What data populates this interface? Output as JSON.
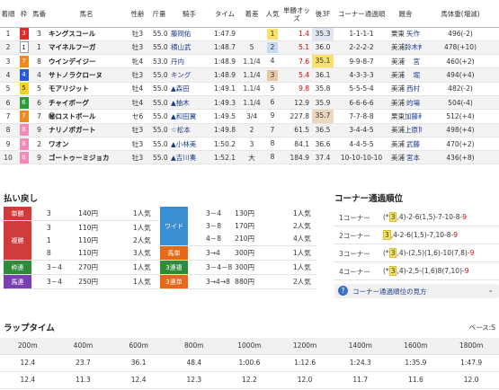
{
  "results": {
    "headers": [
      "着順",
      "枠",
      "馬番",
      "馬名",
      "性齢",
      "斤量",
      "騎手",
      "タイム",
      "着差",
      "人気",
      "単勝オッズ",
      "後3F",
      "コーナー通過順",
      "厩舎",
      "馬体重(増減)"
    ],
    "rows": [
      {
        "rank": "1",
        "frame": "3",
        "num": "3",
        "name": "キングスコール",
        "sex_age": "牡3",
        "weight": "55.0",
        "jockey": "藤岡佑",
        "time": "1:47.9",
        "margin": "",
        "pop": "1",
        "odds": "1.4",
        "last3f": "35.3",
        "corner": "1-1-1-1",
        "trainer": "矢作",
        "stable": "栗東",
        "bw": "496(-2)"
      },
      {
        "rank": "2",
        "frame": "1",
        "num": "1",
        "name": "マイネルフーガ",
        "sex_age": "牡3",
        "weight": "55.0",
        "jockey": "横山武",
        "time": "1:48.7",
        "margin": "5",
        "pop": "2",
        "odds": "5.1",
        "last3f": "36.0",
        "corner": "2-2-2-2",
        "trainer": "鈴木伸",
        "stable": "美浦",
        "bw": "478(+10)"
      },
      {
        "rank": "3",
        "frame": "7",
        "num": "8",
        "name": "ウインデイジー",
        "sex_age": "牝4",
        "weight": "53.0",
        "jockey": "丹内",
        "time": "1:48.9",
        "margin": "1.1/4",
        "pop": "4",
        "odds": "7.6",
        "last3f": "35.1",
        "corner": "9-9-8-7",
        "trainer": "宮",
        "stable": "美浦",
        "bw": "460(+2)"
      },
      {
        "rank": "4",
        "frame": "4",
        "num": "4",
        "name": "サトノラクローヌ",
        "sex_age": "牡3",
        "weight": "55.0",
        "jockey": "キング",
        "time": "1:48.9",
        "margin": "1.1/4",
        "pop": "3",
        "odds": "5.4",
        "last3f": "36.1",
        "corner": "4-3-3-3",
        "trainer": "堀",
        "stable": "美浦",
        "bw": "494(+4)"
      },
      {
        "rank": "5",
        "frame": "5",
        "num": "5",
        "name": "モアリジット",
        "sex_age": "牡4",
        "weight": "55.0",
        "jockey": "▲森田",
        "time": "1:49.1",
        "margin": "1.1/4",
        "pop": "5",
        "odds": "9.8",
        "last3f": "35.8",
        "corner": "5-5-5-4",
        "trainer": "西村",
        "stable": "美浦",
        "bw": "482(-2)"
      },
      {
        "rank": "6",
        "frame": "6",
        "num": "6",
        "name": "チャイボーグ",
        "sex_age": "牡4",
        "weight": "55.0",
        "jockey": "▲柚木",
        "time": "1:49.3",
        "margin": "1.1/4",
        "pop": "6",
        "odds": "12.9",
        "last3f": "35.9",
        "corner": "6-6-6-6",
        "trainer": "的場",
        "stable": "美浦",
        "bw": "504(-4)"
      },
      {
        "rank": "7",
        "frame": "7",
        "num": "7",
        "name": "㊙ロストボール",
        "sex_age": "セ6",
        "weight": "55.0",
        "jockey": "▲和田翼",
        "time": "1:49.5",
        "margin": "3/4",
        "pop": "9",
        "odds": "227.8",
        "last3f": "35.7",
        "corner": "7-7-8-8",
        "trainer": "加藤和",
        "stable": "栗東",
        "bw": "512(+4)"
      },
      {
        "rank": "8",
        "frame": "8",
        "num": "9",
        "name": "ナリノボガート",
        "sex_age": "牡3",
        "weight": "55.0",
        "jockey": "☆松本",
        "time": "1:49.8",
        "margin": "2",
        "pop": "7",
        "odds": "61.5",
        "last3f": "36.5",
        "corner": "3-4-4-5",
        "trainer": "上原博",
        "stable": "美浦",
        "bw": "498(+4)"
      },
      {
        "rank": "9",
        "frame": "8",
        "num": "2",
        "name": "ワオン",
        "sex_age": "牡3",
        "weight": "55.0",
        "jockey": "▲小林美",
        "time": "1:50.2",
        "margin": "3",
        "pop": "8",
        "odds": "84.1",
        "last3f": "36.6",
        "corner": "4-4-5-5",
        "trainer": "武藤",
        "stable": "美浦",
        "bw": "470(+2)"
      },
      {
        "rank": "10",
        "frame": "8",
        "num": "9",
        "name": "ゴートゥーミジョカ",
        "sex_age": "牡3",
        "weight": "55.0",
        "jockey": "▲吉川奏",
        "time": "1:52.1",
        "margin": "大",
        "pop": "8",
        "odds": "184.9",
        "last3f": "37.4",
        "corner": "10-10-10-10",
        "trainer": "宮本",
        "stable": "美浦",
        "bw": "436(+8)"
      }
    ]
  },
  "frame_colors": {
    "1": "#ffffff",
    "2": "#222222",
    "3": "#e02a2a",
    "4": "#2a5bd7",
    "5": "#f2d22a",
    "6": "#2f9a3a",
    "7": "#f08a1e",
    "8": "#f28cb6"
  },
  "payouts": {
    "title": "払い戻し",
    "left": [
      {
        "label": "単勝",
        "color": "#d23b3b",
        "rows": [
          {
            "combo": "3",
            "amount": "140円",
            "pop": "1人気"
          }
        ]
      },
      {
        "label": "複勝",
        "color": "#d23b3b",
        "rows": [
          {
            "combo": "3",
            "amount": "110円",
            "pop": "1人気"
          },
          {
            "combo": "1",
            "amount": "110円",
            "pop": "2人気"
          },
          {
            "combo": "8",
            "amount": "110円",
            "pop": "3人気"
          }
        ]
      },
      {
        "label": "枠連",
        "color": "#2f8a3a",
        "rows": [
          {
            "combo": "3－4",
            "amount": "270円",
            "pop": "1人気"
          }
        ]
      },
      {
        "label": "馬連",
        "color": "#7a3fb0",
        "rows": [
          {
            "combo": "3－4",
            "amount": "250円",
            "pop": "1人気"
          }
        ]
      }
    ],
    "right": [
      {
        "label": "ワイド",
        "color": "#3a8fd3",
        "rows": [
          {
            "combo": "3－4",
            "amount": "130円",
            "pop": "1人気"
          },
          {
            "combo": "3－8",
            "amount": "170円",
            "pop": "2人気"
          },
          {
            "combo": "4－8",
            "amount": "210円",
            "pop": "4人気"
          }
        ]
      },
      {
        "label": "馬単",
        "color": "#e46a1a",
        "rows": [
          {
            "combo": "3→4",
            "amount": "300円",
            "pop": "1人気"
          }
        ]
      },
      {
        "label": "3連複",
        "color": "#2f8a3a",
        "rows": [
          {
            "combo": "3－4－8",
            "amount": "300円",
            "pop": "1人気"
          }
        ]
      },
      {
        "label": "3連単",
        "color": "#e46a1a",
        "rows": [
          {
            "combo": "3→4→8",
            "amount": "880円",
            "pop": "2人気"
          }
        ]
      }
    ]
  },
  "corners": {
    "title": "コーナー通過順位",
    "link": "コーナー通過順位の見方",
    "rows": [
      {
        "label": "1コーナー",
        "pre": "(*",
        "hi": "3",
        "post": ",4)-2-6(1,5)-7-10-8-",
        "red": "9"
      },
      {
        "label": "2コーナー",
        "pre": "",
        "hi": "3",
        "post": ",4-2-6(1,5)-7,10-8-",
        "red": "9"
      },
      {
        "label": "3コーナー",
        "pre": "(*",
        "hi": "3",
        "post": ",4)-(2,5)(1,6)-10(7,8)-",
        "red": "9"
      },
      {
        "label": "4コーナー",
        "pre": "(*",
        "hi": "3",
        "post": ",4)-2,5-(1,6)8(7,10)-",
        "red": "9"
      }
    ]
  },
  "laps": {
    "title": "ラップタイム",
    "pace": "ペース:S",
    "distances": [
      "200m",
      "400m",
      "600m",
      "800m",
      "1000m",
      "1200m",
      "1400m",
      "1600m",
      "1800m"
    ],
    "cumulative": [
      "12.4",
      "23.7",
      "36.1",
      "48.4",
      "1:00.6",
      "1:12.6",
      "1:24.3",
      "1:35.9",
      "1:47.9"
    ],
    "splits": [
      "12.4",
      "11.3",
      "12.4",
      "12.3",
      "12.2",
      "12.0",
      "11.7",
      "11.6",
      "12.0"
    ]
  }
}
